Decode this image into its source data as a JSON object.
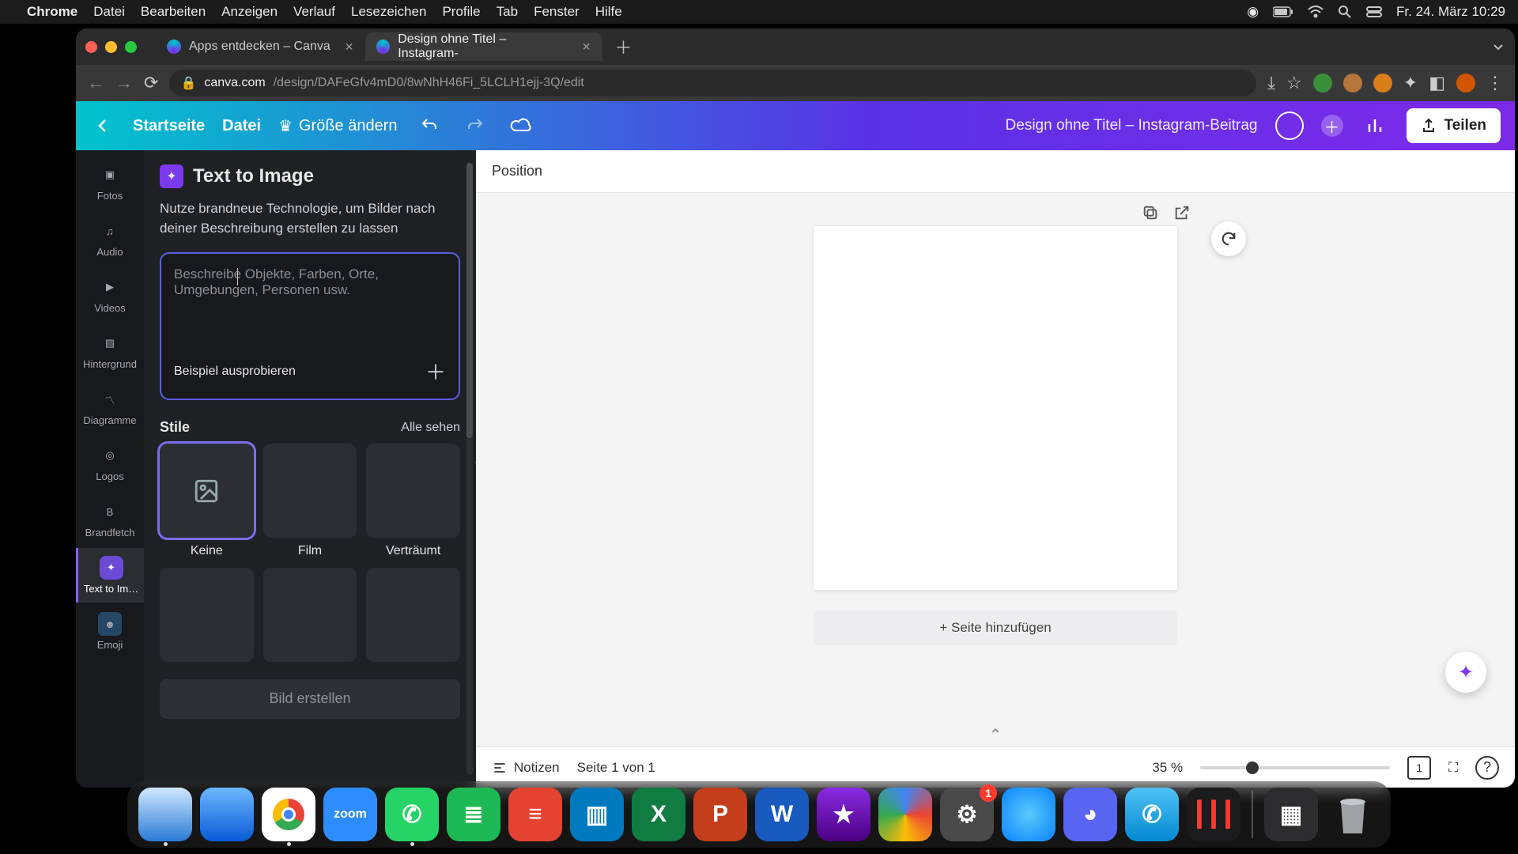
{
  "menubar": {
    "app": "Chrome",
    "items": [
      "Datei",
      "Bearbeiten",
      "Anzeigen",
      "Verlauf",
      "Lesezeichen",
      "Profile",
      "Tab",
      "Fenster",
      "Hilfe"
    ],
    "clock": "Fr. 24. März  10:29"
  },
  "tabs": {
    "t1": "Apps entdecken – Canva",
    "t2": "Design ohne Titel – Instagram-"
  },
  "url": {
    "host": "canva.com",
    "path": "/design/DAFeGfv4mD0/8wNhH46Fi_5LCLH1ejj-3Q/edit"
  },
  "apptop": {
    "home": "Startseite",
    "file": "Datei",
    "resize": "Größe ändern",
    "title": "Design ohne Titel – Instagram-Beitrag",
    "share": "Teilen"
  },
  "rail": {
    "fotos": "Fotos",
    "audio": "Audio",
    "videos": "Videos",
    "hintergrund": "Hintergrund",
    "diagramme": "Diagramme",
    "logos": "Logos",
    "brandfetch": "Brandfetch",
    "texttoimage": "Text to Im…",
    "emoji": "Emoji"
  },
  "panel": {
    "title": "Text to Image",
    "desc": "Nutze brandneue Technologie, um Bilder nach deiner Beschreibung erstellen zu lassen",
    "placeholder": "Beschreibe Objekte, Farben, Orte, Umgebungen, Personen usw.",
    "try": "Beispiel ausprobieren",
    "styles_label": "Stile",
    "see_all": "Alle sehen",
    "styles": {
      "none": "Keine",
      "film": "Film",
      "dream": "Verträumt"
    },
    "generate": "Bild erstellen"
  },
  "canvas": {
    "position": "Position",
    "add_page": "+ Seite hinzufügen",
    "notes": "Notizen",
    "page_of": "Seite 1 von 1",
    "zoom": "35 %",
    "pages_badge": "1"
  },
  "dock": {
    "badge": "1"
  }
}
